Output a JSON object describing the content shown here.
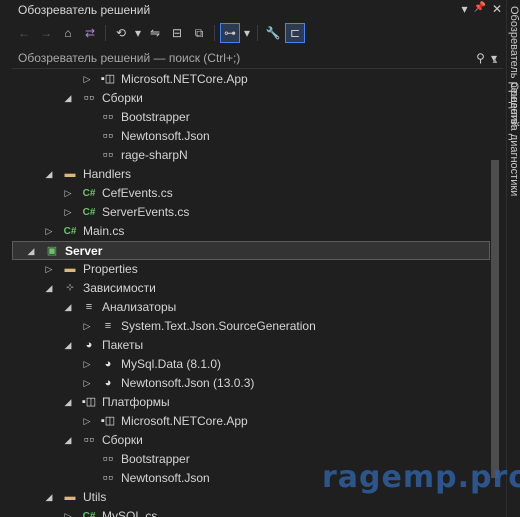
{
  "window": {
    "title": "Обозреватель решений",
    "pin_glyph": "📌",
    "menu_glyph": "▾",
    "close_glyph": "✕"
  },
  "toolbar": {
    "back": "←",
    "forward": "→",
    "home": "⌂",
    "vs_switch": "⇄",
    "history": "⟲",
    "history_dropdown": "▾",
    "sync": "⇋",
    "collapse": "⊟",
    "show_all": "⧉",
    "view_toggle": "⊶",
    "view_dropdown": "▾",
    "properties": "🔧",
    "preview": "⊏"
  },
  "search": {
    "placeholder": "Обозреватель решений — поиск (Ctrl+;)",
    "search_glyph": "⚲",
    "dropdown_glyph": "▾"
  },
  "side_tabs": [
    "Обозреватель решений",
    "Средства диагностики"
  ],
  "tree": [
    {
      "indent": 3,
      "arrow": "▷",
      "icon": "ic-pkg",
      "glyph": "▪◫",
      "label": "Microsoft.NETCore.App"
    },
    {
      "indent": 2,
      "arrow": "◢",
      "icon": "ic-ref",
      "glyph": "▫▫",
      "label": "Сборки"
    },
    {
      "indent": 3,
      "arrow": "",
      "icon": "ic-ref",
      "glyph": "▫▫",
      "label": "Bootstrapper"
    },
    {
      "indent": 3,
      "arrow": "",
      "icon": "ic-ref",
      "glyph": "▫▫",
      "label": "Newtonsoft.Json"
    },
    {
      "indent": 3,
      "arrow": "",
      "icon": "ic-ref",
      "glyph": "▫▫",
      "label": "rage-sharpN"
    },
    {
      "indent": 1,
      "arrow": "◢",
      "icon": "ic-folder",
      "glyph": "▬",
      "label": "Handlers"
    },
    {
      "indent": 2,
      "arrow": "▷",
      "icon": "ic-cs",
      "glyph": "C#",
      "label": "CefEvents.cs"
    },
    {
      "indent": 2,
      "arrow": "▷",
      "icon": "ic-cs",
      "glyph": "C#",
      "label": "ServerEvents.cs"
    },
    {
      "indent": 1,
      "arrow": "▷",
      "icon": "ic-cs",
      "glyph": "C#",
      "label": "Main.cs"
    },
    {
      "indent": 0,
      "arrow": "◢",
      "icon": "ic-proj",
      "glyph": "▣",
      "label": "Server",
      "bold": true,
      "selected": true
    },
    {
      "indent": 1,
      "arrow": "▷",
      "icon": "ic-folder",
      "glyph": "▬",
      "label": "Properties"
    },
    {
      "indent": 1,
      "arrow": "◢",
      "icon": "ic-ref",
      "glyph": "⊹",
      "label": "Зависимости"
    },
    {
      "indent": 2,
      "arrow": "◢",
      "icon": "ic-analyzer",
      "glyph": "≡",
      "label": "Анализаторы"
    },
    {
      "indent": 3,
      "arrow": "▷",
      "icon": "ic-analyzer",
      "glyph": "≡",
      "label": "System.Text.Json.SourceGeneration"
    },
    {
      "indent": 2,
      "arrow": "◢",
      "icon": "ic-pkg",
      "glyph": "◕",
      "label": "Пакеты"
    },
    {
      "indent": 3,
      "arrow": "▷",
      "icon": "ic-pkg",
      "glyph": "◕",
      "label": "MySql.Data (8.1.0)"
    },
    {
      "indent": 3,
      "arrow": "▷",
      "icon": "ic-pkg",
      "glyph": "◕",
      "label": "Newtonsoft.Json (13.0.3)"
    },
    {
      "indent": 2,
      "arrow": "◢",
      "icon": "ic-pkg",
      "glyph": "▪◫",
      "label": "Платформы"
    },
    {
      "indent": 3,
      "arrow": "▷",
      "icon": "ic-pkg",
      "glyph": "▪◫",
      "label": "Microsoft.NETCore.App"
    },
    {
      "indent": 2,
      "arrow": "◢",
      "icon": "ic-ref",
      "glyph": "▫▫",
      "label": "Сборки"
    },
    {
      "indent": 3,
      "arrow": "",
      "icon": "ic-ref",
      "glyph": "▫▫",
      "label": "Bootstrapper"
    },
    {
      "indent": 3,
      "arrow": "",
      "icon": "ic-ref",
      "glyph": "▫▫",
      "label": "Newtonsoft.Json"
    },
    {
      "indent": 1,
      "arrow": "◢",
      "icon": "ic-folder",
      "glyph": "▬",
      "label": "Utils"
    },
    {
      "indent": 2,
      "arrow": "▷",
      "icon": "ic-cs",
      "glyph": "C#",
      "label": "MySQL.cs"
    }
  ],
  "watermark": "ragemp.pro"
}
